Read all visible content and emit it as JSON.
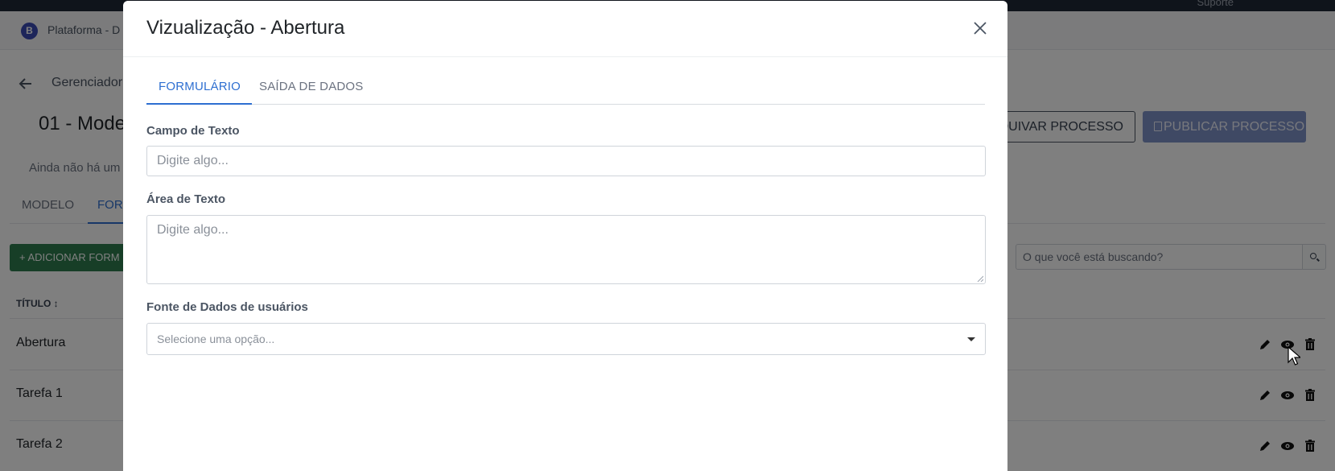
{
  "topbar": {
    "user_label": "Suporte"
  },
  "app_header": {
    "logo_letter": "B",
    "platform_name": "Plataforma - D"
  },
  "breadcrumb": {
    "text": "Gerenciador"
  },
  "process": {
    "title": "01 - Mode",
    "empty_message": "Ainda não há um"
  },
  "actions": {
    "archive_label": "ARQUIVAR PROCESSO",
    "publish_label": "PUBLICAR PROCESSO"
  },
  "page_tabs": [
    {
      "label": "MODELO"
    },
    {
      "label": "FOR"
    }
  ],
  "add_button_label": "ADICIONAR FORM",
  "search": {
    "placeholder": "O que você está buscando?"
  },
  "table": {
    "column_title": "TÍTULO",
    "rows": [
      {
        "title": "Abertura"
      },
      {
        "title": "Tarefa 1"
      },
      {
        "title": "Tarefa 2"
      }
    ]
  },
  "modal": {
    "title": "Vizualização - Abertura",
    "tabs": [
      {
        "label": "FORMULÁRIO",
        "active": true
      },
      {
        "label": "SAÍDA DE DADOS",
        "active": false
      }
    ],
    "fields": {
      "text_field": {
        "label": "Campo de Texto",
        "placeholder": "Digite algo..."
      },
      "text_area": {
        "label": "Área de Texto",
        "placeholder": "Digite algo..."
      },
      "user_source": {
        "label": "Fonte de Dados de usuários",
        "placeholder": "Selecione uma opção..."
      }
    }
  },
  "colors": {
    "primary": "#2e6fd1",
    "success": "#2e7d4f",
    "publish": "#7f93c9",
    "overlay": "rgba(0,0,0,0.5)"
  }
}
